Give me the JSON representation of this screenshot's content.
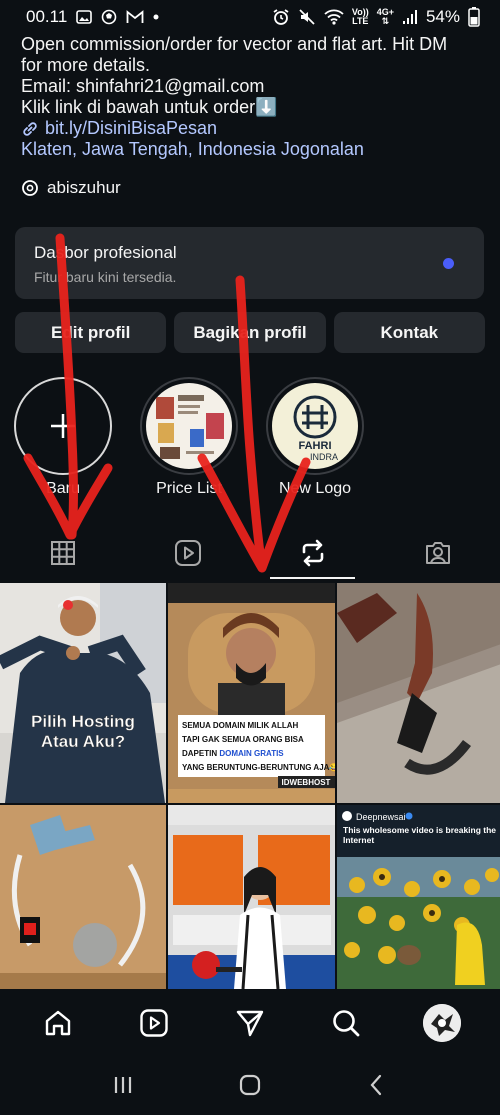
{
  "status_bar": {
    "time": "00.11",
    "battery": "54%",
    "signal_tag_top": "Vo))",
    "signal_tag_bottom": "LTE",
    "net_tag": "4G+"
  },
  "bio": {
    "line1": "Open commission/order for vector and flat art. Hit DM",
    "line2": "for more details.",
    "email": "Email: shinfahri21@gmail.com",
    "order": "Klik link di bawah untuk order⬇️",
    "link": "bit.ly/DisiniBisaPesan",
    "location": "Klaten, Jawa Tengah, Indonesia Jogonalan",
    "threads": "abiszuhur"
  },
  "dashboard": {
    "title": "Dasbor profesional",
    "subtitle": "Fitur baru kini tersedia.",
    "dot_color": "#4a5df9"
  },
  "buttons": {
    "edit": "Edit profil",
    "share": "Bagikan profil",
    "contact": "Kontak"
  },
  "highlights": [
    {
      "label": "Baru",
      "icon": "plus-icon"
    },
    {
      "label": "Price List",
      "icon": "price-list-thumbnail"
    },
    {
      "label": "New Logo",
      "icon": "new-logo-thumbnail"
    }
  ],
  "new_logo_text": {
    "top": "FAHRI",
    "bottom": "INDRA"
  },
  "tabs": [
    {
      "name": "grid",
      "icon": "grid-icon"
    },
    {
      "name": "reels",
      "icon": "reels-icon"
    },
    {
      "name": "reposts",
      "icon": "repost-icon",
      "active": true
    },
    {
      "name": "tagged",
      "icon": "tagged-icon"
    }
  ],
  "posts": {
    "p1_caption_1": "Pilih Hosting",
    "p1_caption_2": "Atau Aku?",
    "p2_caption_1": "SEMUA DOMAIN MILIK ALLAH",
    "p2_caption_2": "TAPI GAK SEMUA ORANG BISA",
    "p2_caption_3a": "DAPETIN ",
    "p2_caption_3b": "DOMAIN GRATIS",
    "p2_caption_4": "YANG BERUNTUNG-BERUNTUNG AJA😂",
    "p2_brand": "IDWEBHOST",
    "p6_source": "Deepnewsai",
    "p6_caption": "This wholesome video is breaking the Internet"
  },
  "colors": {
    "background": "#0c1014",
    "card": "#25292e",
    "link": "#b4c8ff",
    "annotation_red": "#e8231c"
  }
}
